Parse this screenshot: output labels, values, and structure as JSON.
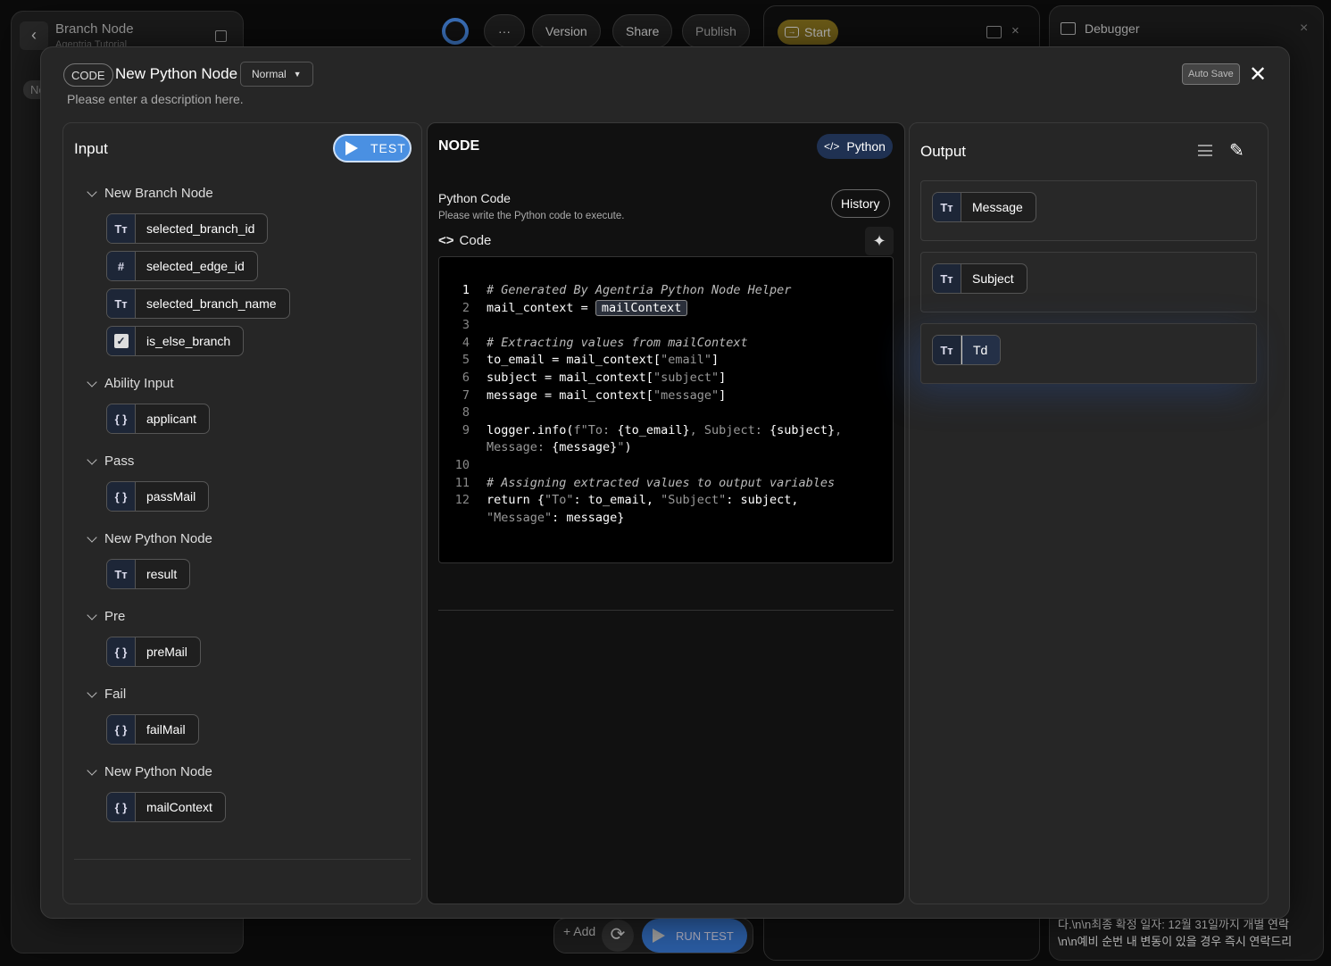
{
  "background": {
    "left_panel": {
      "title": "Branch Node",
      "subtitle": "Agentria Tutorial",
      "tab_label": "Ne"
    },
    "toolbar": {
      "more_label": "···",
      "version_label": "Version",
      "share_label": "Share",
      "publish_label": "Publish"
    },
    "start_panel": {
      "start_label": "Start"
    },
    "debugger": {
      "title": "Debugger",
      "log_lines": [
        "다.\\n\\n최종 확정 일자: 12월 31일까지 개별 연락",
        "\\n\\n예비 순번 내 변동이 있을 경우 즉시 연락드리"
      ]
    },
    "bottom": {
      "add_label": "+ Add",
      "run_test_label": "RUN TEST"
    }
  },
  "modal": {
    "type_tag": "CODE",
    "title": "New Python Node",
    "mode": "Normal",
    "description": "Please enter a description here.",
    "auto_save_label": "Auto Save",
    "input": {
      "title": "Input",
      "test_label": "TEST",
      "groups": [
        {
          "name": "New Branch Node",
          "vars": [
            {
              "type": "text",
              "label": "selected_branch_id"
            },
            {
              "type": "number",
              "label": "selected_edge_id"
            },
            {
              "type": "text",
              "label": "selected_branch_name"
            },
            {
              "type": "boolean",
              "label": "is_else_branch"
            }
          ]
        },
        {
          "name": "Ability Input",
          "vars": [
            {
              "type": "object",
              "label": "applicant"
            }
          ]
        },
        {
          "name": "Pass",
          "vars": [
            {
              "type": "object",
              "label": "passMail"
            }
          ]
        },
        {
          "name": "New Python Node",
          "vars": [
            {
              "type": "text",
              "label": "result"
            }
          ]
        },
        {
          "name": "Pre",
          "vars": [
            {
              "type": "object",
              "label": "preMail"
            }
          ]
        },
        {
          "name": "Fail",
          "vars": [
            {
              "type": "object",
              "label": "failMail"
            }
          ]
        },
        {
          "name": "New Python Node",
          "vars": [
            {
              "type": "object",
              "label": "mailContext"
            }
          ]
        }
      ]
    },
    "node": {
      "title": "NODE",
      "language": "Python",
      "section_title": "Python Code",
      "section_desc": "Please write the Python code to execute.",
      "history_label": "History",
      "code_label": "Code",
      "code_lines": [
        {
          "n": "1",
          "segs": [
            [
              "cm",
              "# Generated By Agentria Python Node Helper"
            ]
          ]
        },
        {
          "n": "2",
          "segs": [
            [
              "",
              "mail_context = "
            ],
            [
              "chip",
              "mailContext"
            ]
          ]
        },
        {
          "n": "3",
          "segs": []
        },
        {
          "n": "4",
          "segs": [
            [
              "cm",
              "# Extracting values from mailContext"
            ]
          ]
        },
        {
          "n": "5",
          "segs": [
            [
              "",
              "to_email = mail_context["
            ],
            [
              "st",
              "\"email\""
            ],
            [
              "",
              "]"
            ]
          ]
        },
        {
          "n": "6",
          "segs": [
            [
              "",
              "subject = mail_context["
            ],
            [
              "st",
              "\"subject\""
            ],
            [
              "",
              "]"
            ]
          ]
        },
        {
          "n": "7",
          "segs": [
            [
              "",
              "message = mail_context["
            ],
            [
              "st",
              "\"message\""
            ],
            [
              "",
              "]"
            ]
          ]
        },
        {
          "n": "8",
          "segs": []
        },
        {
          "n": "9",
          "segs": [
            [
              "",
              "logger.info("
            ],
            [
              "st",
              "f\"To: "
            ],
            [
              "",
              "{to_email}"
            ],
            [
              "st",
              ", Subject: "
            ],
            [
              "",
              "{subject}"
            ],
            [
              "st",
              ", Message: "
            ],
            [
              "",
              "{message}"
            ],
            [
              "st",
              "\""
            ],
            [
              "",
              ")"
            ]
          ]
        },
        {
          "n": "10",
          "segs": []
        },
        {
          "n": "11",
          "segs": [
            [
              "cm",
              "# Assigning extracted values to output variables"
            ]
          ]
        },
        {
          "n": "12",
          "segs": [
            [
              "",
              "return {"
            ],
            [
              "st",
              "\"To\""
            ],
            [
              "",
              ": to_email, "
            ],
            [
              "st",
              "\"Subject\""
            ],
            [
              "",
              ": subject, "
            ],
            [
              "st",
              "\"Message\""
            ],
            [
              "",
              ": message}"
            ]
          ]
        }
      ]
    },
    "output": {
      "title": "Output",
      "vars": [
        {
          "type": "text",
          "label": "Message"
        },
        {
          "type": "text",
          "label": "Subject"
        },
        {
          "type": "text",
          "label": "Td",
          "editing": true
        }
      ]
    }
  },
  "colors": {
    "accent": "#4a90e2",
    "start_badge": "#6b5a17",
    "run_test": "#2a5ba0"
  }
}
